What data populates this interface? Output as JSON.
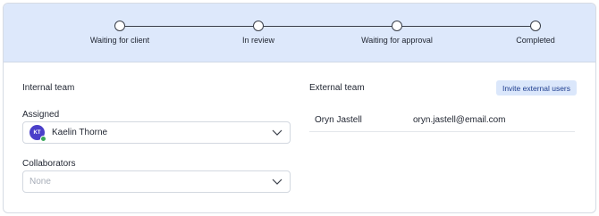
{
  "progress": {
    "steps": [
      {
        "label": "Waiting for client"
      },
      {
        "label": "In review"
      },
      {
        "label": "Waiting for approval"
      },
      {
        "label": "Completed"
      }
    ]
  },
  "internal_team": {
    "title": "Internal team",
    "assigned": {
      "label": "Assigned",
      "avatar_initials": "KT",
      "value": "Kaelin Thorne",
      "status_color": "#3aa85a",
      "avatar_color": "#4a3fc9"
    },
    "collaborators": {
      "label": "Collaborators",
      "placeholder": "None"
    }
  },
  "external_team": {
    "title": "External team",
    "invite_label": "Invite external users",
    "users": [
      {
        "name": "Oryn Jastell",
        "email": "oryn.jastell@email.com"
      }
    ]
  },
  "icons": [
    "chevron-down-icon"
  ],
  "colors": {
    "accent": "#dde8fb",
    "button_text": "#1e3d8f"
  }
}
